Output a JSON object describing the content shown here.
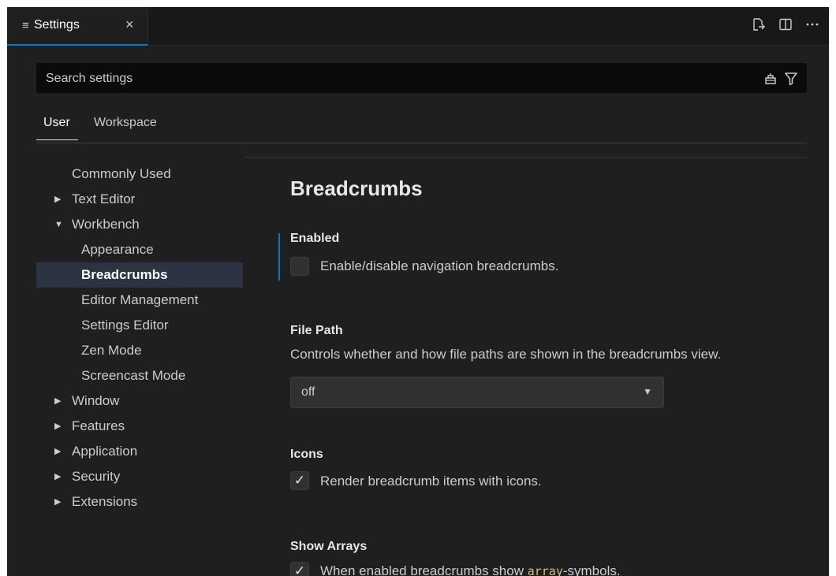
{
  "tab": {
    "icon": "settings-list-icon",
    "label": "Settings",
    "close": "×"
  },
  "tab_actions": [
    {
      "name": "open-settings-json-icon"
    },
    {
      "name": "split-editor-icon"
    },
    {
      "name": "more-actions-icon"
    }
  ],
  "search": {
    "placeholder": "Search settings",
    "value": ""
  },
  "scope_tabs": [
    {
      "label": "User",
      "active": true
    },
    {
      "label": "Workspace",
      "active": false
    }
  ],
  "tree": [
    {
      "label": "Commonly Used",
      "level": 0,
      "twistie": ""
    },
    {
      "label": "Text Editor",
      "level": 0,
      "twistie": "collapsed"
    },
    {
      "label": "Workbench",
      "level": 0,
      "twistie": "expanded"
    },
    {
      "label": "Appearance",
      "level": 1,
      "twistie": ""
    },
    {
      "label": "Breadcrumbs",
      "level": 1,
      "twistie": "",
      "selected": true
    },
    {
      "label": "Editor Management",
      "level": 1,
      "twistie": ""
    },
    {
      "label": "Settings Editor",
      "level": 1,
      "twistie": ""
    },
    {
      "label": "Zen Mode",
      "level": 1,
      "twistie": ""
    },
    {
      "label": "Screencast Mode",
      "level": 1,
      "twistie": ""
    },
    {
      "label": "Window",
      "level": 0,
      "twistie": "collapsed"
    },
    {
      "label": "Features",
      "level": 0,
      "twistie": "collapsed"
    },
    {
      "label": "Application",
      "level": 0,
      "twistie": "collapsed"
    },
    {
      "label": "Security",
      "level": 0,
      "twistie": "collapsed"
    },
    {
      "label": "Extensions",
      "level": 0,
      "twistie": "collapsed"
    }
  ],
  "main": {
    "section_title": "Breadcrumbs",
    "enabled": {
      "title": "Enabled",
      "checked": false,
      "label": "Enable/disable navigation breadcrumbs."
    },
    "file_path": {
      "title": "File Path",
      "desc": "Controls whether and how file paths are shown in the breadcrumbs view.",
      "value": "off"
    },
    "icons": {
      "title": "Icons",
      "checked": true,
      "label": "Render breadcrumb items with icons."
    },
    "show_arrays": {
      "title": "Show Arrays",
      "checked": true,
      "label_before": "When enabled breadcrumbs show ",
      "label_code": "array",
      "label_after": "-symbols."
    }
  },
  "glyphs": {
    "twistie_collapsed": "▶",
    "twistie_expanded": "▼",
    "check": "✓",
    "dropdown": "▼"
  },
  "colors": {
    "accent": "#0078d4",
    "selected_bg": "#2c3343",
    "code": "#d7ba7d"
  }
}
